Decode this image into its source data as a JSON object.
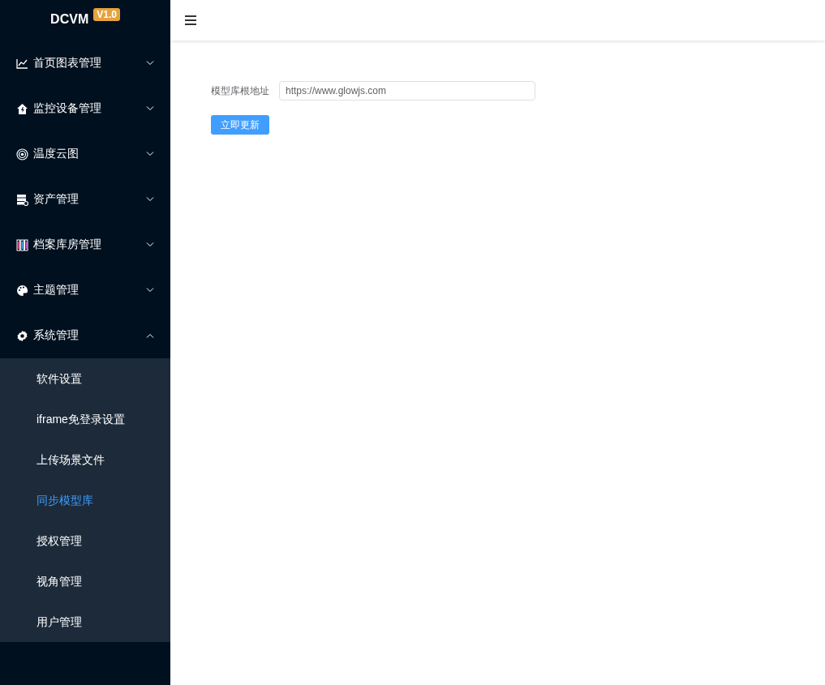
{
  "sidebar": {
    "logo": "DCVM",
    "version": "V1.0",
    "items": [
      {
        "label": "首页图表管理",
        "expanded": false
      },
      {
        "label": "监控设备管理",
        "expanded": false
      },
      {
        "label": "温度云图",
        "expanded": false
      },
      {
        "label": "资产管理",
        "expanded": false
      },
      {
        "label": "档案库房管理",
        "expanded": false
      },
      {
        "label": "主题管理",
        "expanded": false
      },
      {
        "label": "系统管理",
        "expanded": true,
        "children": [
          {
            "label": "软件设置",
            "selected": false
          },
          {
            "label": "iframe免登录设置",
            "selected": false
          },
          {
            "label": "上传场景文件",
            "selected": false
          },
          {
            "label": "同步模型库",
            "selected": true
          },
          {
            "label": "授权管理",
            "selected": false
          },
          {
            "label": "视角管理",
            "selected": false
          },
          {
            "label": "用户管理",
            "selected": false
          }
        ]
      }
    ]
  },
  "form": {
    "label": "模型库根地址",
    "value": "https://www.glowjs.com",
    "button": "立即更新"
  }
}
